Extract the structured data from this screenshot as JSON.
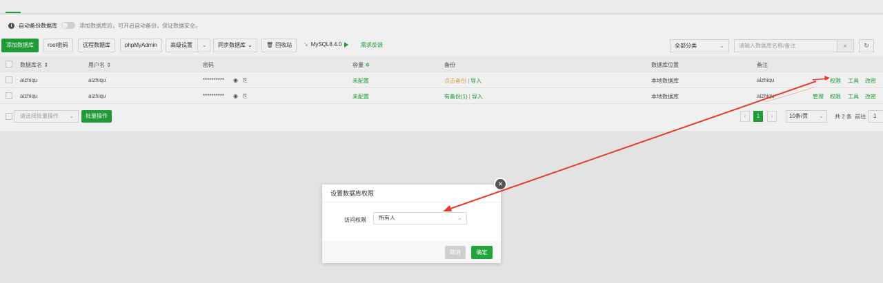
{
  "notice": {
    "label": "自动备份数据库",
    "hint": "添加数据库后，可开启自动备份，保证数据安全。"
  },
  "toolbar": {
    "add_db": "添加数据库",
    "root_pwd": "root密码",
    "remote_db": "远程数据库",
    "phpmyadmin": "phpMyAdmin",
    "advanced": "高级设置",
    "sync": "同步数据库",
    "sync_caret": "⌄",
    "recycle": "回收站",
    "mysql_version": "MySQL8.4.0",
    "feedback": "需求反馈",
    "category": "全部分类",
    "search_placeholder": "请输入数据库名称/备注"
  },
  "table": {
    "headers": {
      "name": "数据库名",
      "user": "用户名",
      "password": "密码",
      "capacity": "容量",
      "backup": "备份",
      "location": "数据库位置",
      "note": "备注"
    },
    "rows": [
      {
        "name": "aizhiqu",
        "user": "aizhiqu",
        "password": "**********",
        "capacity": "未配置",
        "backup": "点击备份",
        "import": "导入",
        "location": "本地数据库",
        "note": "aizhiqu",
        "actions": [
          "权限",
          "工具",
          "改密"
        ]
      },
      {
        "name": "aizhiqu",
        "user": "aizhiqu",
        "password": "**********",
        "capacity": "未配置",
        "backup": "有备份(1)",
        "import": "导入",
        "location": "本地数据库",
        "note": "aizhiqu",
        "actions": [
          "管理",
          "权限",
          "工具",
          "改密"
        ]
      }
    ]
  },
  "footer": {
    "batch_placeholder": "请选择批量操作",
    "batch_button": "批量操作",
    "current_page": "1",
    "per_page": "10条/页",
    "total": "共 2 条",
    "goto_label": "前往",
    "goto_value": "1"
  },
  "dialog": {
    "title": "设置数据库权限",
    "field_label": "访问权限",
    "field_value": "所有人",
    "cancel": "取消",
    "ok": "确定"
  },
  "colors": {
    "accent": "#20a53a",
    "annotation_arrow": "#e8392b"
  }
}
